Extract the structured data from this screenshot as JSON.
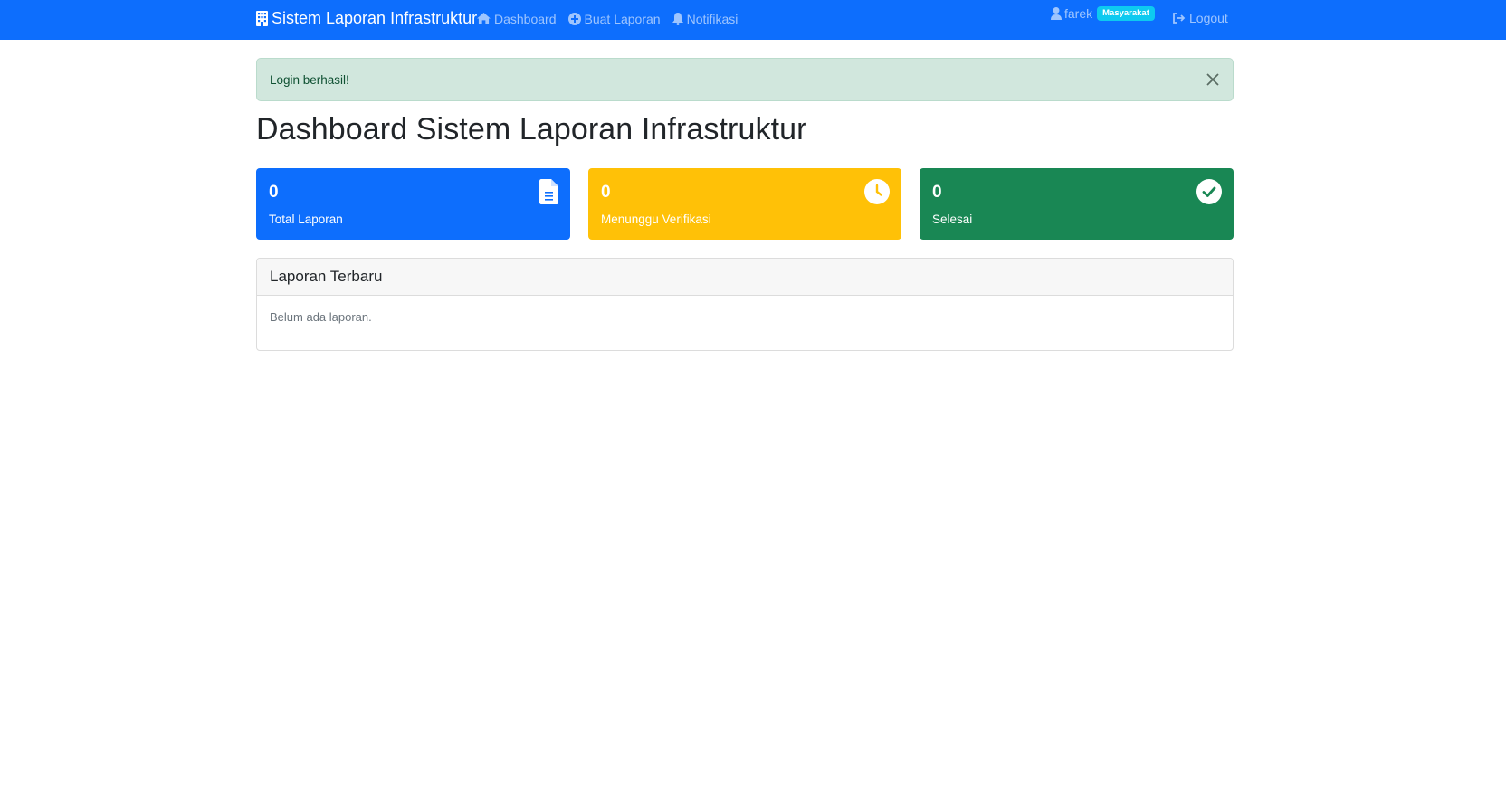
{
  "navbar": {
    "brand": "Sistem Laporan Infrastruktur",
    "brand_icon": "building-icon",
    "links": [
      {
        "label": "Dashboard",
        "icon": "house-icon"
      },
      {
        "label": "Buat Laporan",
        "icon": "plus-circle-icon"
      },
      {
        "label": "Notifikasi",
        "icon": "bell-icon"
      }
    ],
    "user": {
      "name": "farek",
      "role_badge": "Masyarakat",
      "icon": "user-icon"
    },
    "logout_label": "Logout",
    "colors": {
      "background": "#0d6efd",
      "badge": "#0dcaf0"
    }
  },
  "alert": {
    "message": "Login berhasil!",
    "type": "success"
  },
  "page_title": "Dashboard Sistem Laporan Infrastruktur",
  "stats": [
    {
      "value": "0",
      "label": "Total Laporan",
      "icon": "file-text-icon",
      "color": "#0d6efd"
    },
    {
      "value": "0",
      "label": "Menunggu Verifikasi",
      "icon": "clock-icon",
      "color": "#ffc107"
    },
    {
      "value": "0",
      "label": "Selesai",
      "icon": "check-circle-icon",
      "color": "#198754"
    }
  ],
  "recent_reports": {
    "title": "Laporan Terbaru",
    "empty_message": "Belum ada laporan."
  }
}
